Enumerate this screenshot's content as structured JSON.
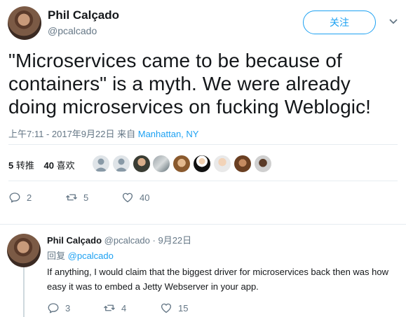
{
  "tweet": {
    "author_name": "Phil Calçado",
    "author_handle": "@pcalcado",
    "follow_label": "关注",
    "text": "\"Microservices came to be because of containers\" is a myth. We were already doing microservices on fucking Weblogic!",
    "timestamp": "上午7:11 - 2017年9月22日 来自",
    "location": "Manhattan, NY",
    "retweets_count": "5",
    "retweets_label": "转推",
    "likes_count": "40",
    "likes_label": "喜欢",
    "actions": {
      "replies": "2",
      "retweets": "5",
      "likes": "40"
    }
  },
  "reply": {
    "author_name": "Phil Calçado",
    "author_handle": "@pcalcado",
    "date": "· 9月22日",
    "reply_to_label": "回复",
    "reply_to_handle": "@pcalcado",
    "text": "If anything, I would claim that the biggest driver for microservices back then was how easy it was to embed a Jetty Webserver in your app.",
    "actions": {
      "replies": "3",
      "retweets": "4",
      "likes": "15"
    }
  },
  "icons": [
    "reply-icon",
    "retweet-icon",
    "like-icon",
    "chevron-down-icon"
  ],
  "colors": {
    "accent": "#1da1f2",
    "muted": "#657786",
    "divider": "#e6ecf0"
  }
}
